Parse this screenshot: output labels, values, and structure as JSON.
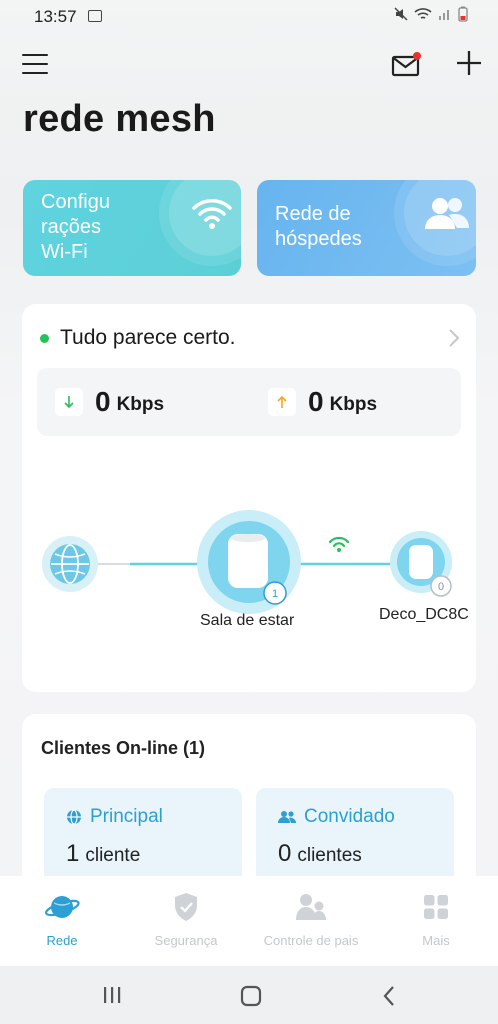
{
  "status_bar": {
    "time": "13:57"
  },
  "header": {
    "title": "rede mesh",
    "menu_icon": "hamburger-icon",
    "mail_icon": "mail-icon",
    "add_icon": "plus-icon"
  },
  "quick_tiles": {
    "wifi": {
      "line1": "Configu",
      "line2": "rações",
      "line3": "Wi-Fi",
      "icon": "wifi-icon"
    },
    "guest": {
      "line1": "Rede de",
      "line2": "hóspedes",
      "icon": "users-icon"
    }
  },
  "status_card": {
    "status_text": "Tudo parece certo.",
    "download": {
      "value": "0",
      "unit": "Kbps"
    },
    "upload": {
      "value": "0",
      "unit": "Kbps"
    },
    "main_node": {
      "label": "Sala de estar",
      "badge": "1"
    },
    "satellite_node": {
      "label": "Deco_DC8C",
      "badge": "0"
    }
  },
  "clients_card": {
    "title": "Clientes On-line (1)",
    "main": {
      "label": "Principal",
      "count": "1",
      "unit": "cliente"
    },
    "guest": {
      "label": "Convidado",
      "count": "0",
      "unit": "clientes"
    }
  },
  "bottom_nav": {
    "items": [
      {
        "label": "Rede",
        "icon": "planet-icon"
      },
      {
        "label": "Segurança",
        "icon": "shield-icon"
      },
      {
        "label": "Controle de pais",
        "icon": "family-icon"
      },
      {
        "label": "Mais",
        "icon": "grid-icon"
      }
    ]
  },
  "colors": {
    "accent": "#2c9fd4",
    "status_ok": "#25c25a",
    "wifi_tile": "#5fd3df",
    "guest_tile": "#6fb9f0",
    "mail_dot": "#e8322e"
  }
}
